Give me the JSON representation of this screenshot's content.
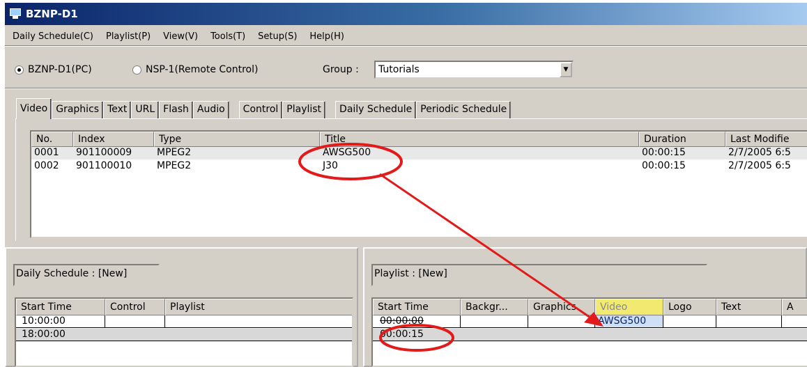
{
  "window": {
    "title": "BZNP-D1"
  },
  "menu": [
    {
      "label": "Daily Schedule(C)"
    },
    {
      "label": "Playlist(P)"
    },
    {
      "label": "View(V)"
    },
    {
      "label": "Tools(T)"
    },
    {
      "label": "Setup(S)"
    },
    {
      "label": "Help(H)"
    }
  ],
  "mode": {
    "options": [
      {
        "label": "BZNP-D1(PC)",
        "selected": true
      },
      {
        "label": "NSP-1(Remote Control)",
        "selected": false
      }
    ],
    "group_label": "Group :",
    "group_value": "Tutorials"
  },
  "tabs": {
    "group1": [
      "Video",
      "Graphics",
      "Text",
      "URL",
      "Flash",
      "Audio"
    ],
    "group2": [
      "Control",
      "Playlist"
    ],
    "group3": [
      "Daily Schedule",
      "Periodic Schedule"
    ],
    "active": "Video"
  },
  "media_table": {
    "columns": [
      "No.",
      "Index",
      "Type",
      "Title",
      "Duration",
      "Last Modifie"
    ],
    "rows": [
      {
        "no": "0001",
        "index": "901100009",
        "type": "MPEG2",
        "title": "AWSG500",
        "duration": "00:00:15",
        "modified": "2/7/2005 6:5"
      },
      {
        "no": "0002",
        "index": "901100010",
        "type": "MPEG2",
        "title": "J30",
        "duration": "00:00:15",
        "modified": "2/7/2005 6:5"
      }
    ]
  },
  "daily_schedule": {
    "caption": "Daily Schedule : [New]",
    "columns": [
      "Start Time",
      "Control",
      "Playlist"
    ],
    "rows": [
      {
        "start": "10:00:00",
        "control": "",
        "playlist": ""
      },
      {
        "start": "18:00:00",
        "control": "",
        "playlist": ""
      }
    ]
  },
  "playlist": {
    "caption": "Playlist : [New]",
    "columns": [
      "Start Time",
      "Backgr...",
      "Graphics",
      "Video",
      "Logo",
      "Text",
      "A"
    ],
    "rows": [
      {
        "start": "00:00:00",
        "video": "AWSG500"
      },
      {
        "start": "00:00:15",
        "video": ""
      }
    ]
  },
  "colors": {
    "annotation": "#e21a1a",
    "title_gradient_start": "#0a246a",
    "highlight_header": "#f2ea70"
  }
}
